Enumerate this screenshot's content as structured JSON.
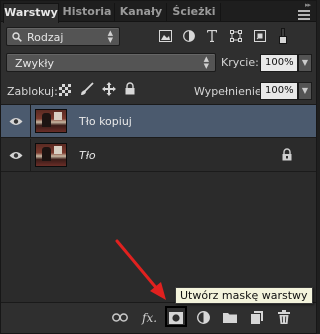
{
  "tabs": [
    {
      "label": "Warstwy",
      "active": true
    },
    {
      "label": "Historia",
      "active": false
    },
    {
      "label": "Kanały",
      "active": false
    },
    {
      "label": "Ścieżki",
      "active": false
    }
  ],
  "filter": {
    "kind_label": "Rodzaj",
    "icons": [
      "image-filter-icon",
      "adjustment-filter-icon",
      "type-filter-icon",
      "shape-filter-icon",
      "smartobject-filter-icon",
      "filter-toggle-icon"
    ]
  },
  "blend": {
    "mode": "Zwykły",
    "opacity_label": "Krycie:",
    "opacity_value": "100%"
  },
  "lock": {
    "label": "Zablokuj:",
    "fill_label": "Wypełnienie:",
    "fill_value": "100%"
  },
  "layers": [
    {
      "name": "Tło kopiuj",
      "selected": true,
      "italic": false,
      "locked": false,
      "visible": true
    },
    {
      "name": "Tło",
      "selected": false,
      "italic": true,
      "locked": true,
      "visible": true
    }
  ],
  "bottom_bar": {
    "icons": [
      "link-layers-icon",
      "fx-icon",
      "add-mask-icon",
      "adjustment-layer-icon",
      "new-group-icon",
      "new-layer-icon",
      "trash-icon"
    ],
    "fx_label": "fx."
  },
  "tooltip": {
    "text": "Utwórz maskę warstwy"
  },
  "colors": {
    "selected_row": "#4b5a6e",
    "annotation_arrow": "#e0211f"
  }
}
